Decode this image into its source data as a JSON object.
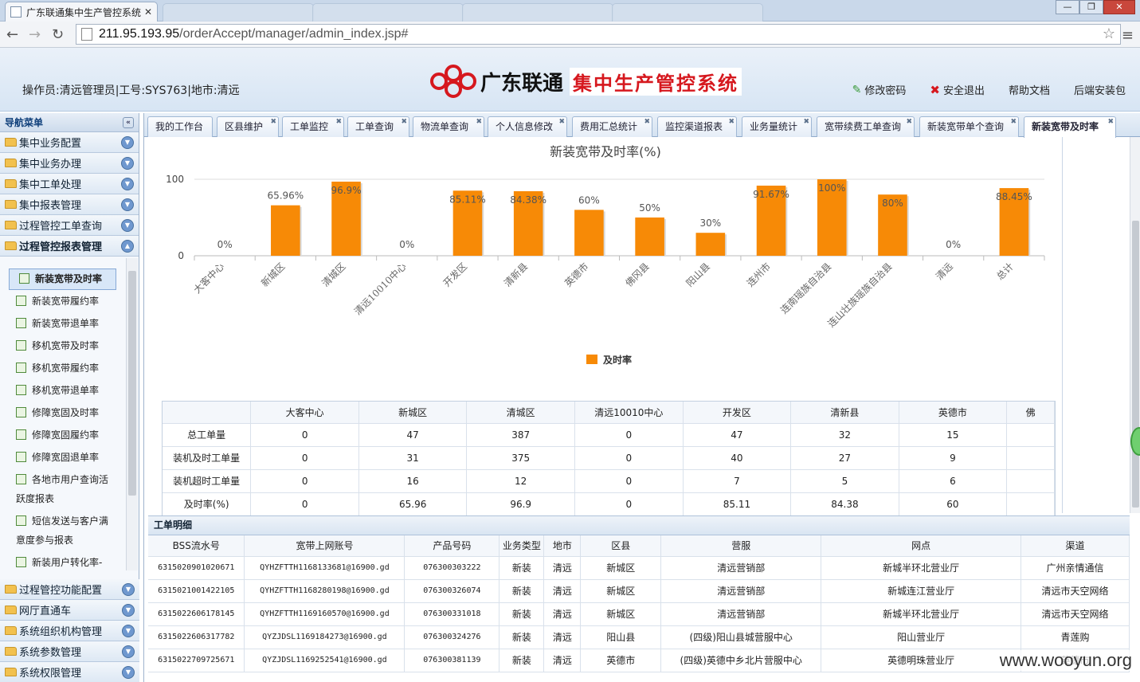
{
  "browser": {
    "tab_title": "广东联通集中生产管控系统",
    "url_host": "211.95.193.95",
    "url_path": "/orderAccept/manager/admin_index.jsp#"
  },
  "header": {
    "operator": "操作员:清远管理员|工号:SYS763|地市:清远",
    "brand": "广东联通",
    "system_name": "集中生产管控系统",
    "links": [
      "修改密码",
      "安全退出",
      "帮助文档",
      "后端安装包"
    ]
  },
  "sidebar": {
    "title": "导航菜单",
    "groups": [
      "集中业务配置",
      "集中业务办理",
      "集中工单处理",
      "集中报表管理",
      "过程管控工单查询",
      "过程管控报表管理"
    ],
    "sub_items": [
      "新装宽带及时率",
      "新装宽带履约率",
      "新装宽带退单率",
      "移机宽带及时率",
      "移机宽带履约率",
      "移机宽带退单率",
      "修障宽固及时率",
      "修障宽固履约率",
      "修障宽固退单率",
      "各地市用户查询活",
      "跃度报表",
      "短信发送与客户满",
      "意度参与报表",
      "新装用户转化率-"
    ],
    "bottom_groups": [
      "过程管控功能配置",
      "网厅直通车",
      "系统组织机构管理",
      "系统参数管理",
      "系统权限管理"
    ]
  },
  "tabs": [
    "我的工作台",
    "区县维护",
    "工单监控",
    "工单查询",
    "物流单查询",
    "个人信息修改",
    "费用汇总统计",
    "监控渠道报表",
    "业务量统计",
    "宽带续费工单查询",
    "新装宽带单个查询",
    "新装宽带及时率"
  ],
  "chart_data": {
    "type": "bar",
    "title": "新装宽带及时率(%)",
    "categories": [
      "大客中心",
      "新城区",
      "清城区",
      "清远10010中心",
      "开发区",
      "清新县",
      "英德市",
      "佛冈县",
      "阳山县",
      "连州市",
      "连南瑶族自治县",
      "连山壮族瑶族自治县",
      "清远",
      "总计"
    ],
    "series": [
      {
        "name": "及时率",
        "values": [
          0,
          65.96,
          96.9,
          0,
          85.11,
          84.38,
          60,
          50,
          30,
          91.67,
          100,
          80,
          0,
          88.45
        ]
      }
    ],
    "value_labels": [
      "0%",
      "65.96%",
      "96.9%",
      "0%",
      "85.11%",
      "84.38%",
      "60%",
      "50%",
      "30%",
      "91.67%",
      "100%",
      "80%",
      "0%",
      "88.45%"
    ],
    "y_ticks": [
      "0",
      "100"
    ],
    "ylim": [
      0,
      100
    ],
    "legend": "bottom",
    "color": "#f78a06"
  },
  "data_table": {
    "headers": [
      "",
      "大客中心",
      "新城区",
      "清城区",
      "清远10010中心",
      "开发区",
      "清新县",
      "英德市",
      "佛"
    ],
    "rows": [
      [
        "总工单量",
        "0",
        "47",
        "387",
        "0",
        "47",
        "32",
        "15",
        ""
      ],
      [
        "装机及时工单量",
        "0",
        "31",
        "375",
        "0",
        "40",
        "27",
        "9",
        ""
      ],
      [
        "装机超时工单量",
        "0",
        "16",
        "12",
        "0",
        "7",
        "5",
        "6",
        ""
      ],
      [
        "及时率(%)",
        "0",
        "65.96",
        "96.9",
        "0",
        "85.11",
        "84.38",
        "60",
        ""
      ]
    ]
  },
  "detail": {
    "title": "工单明细",
    "headers": [
      "BSS流水号",
      "宽带上网账号",
      "产品号码",
      "业务类型",
      "地市",
      "区县",
      "营服",
      "网点",
      "渠道"
    ],
    "rows": [
      [
        "6315020901020671",
        "QYHZFTTH1168133681@16900.gd",
        "076300303222",
        "新装",
        "清远",
        "新城区",
        "清远营销部",
        "新城半环北营业厅",
        "广州亲情通信"
      ],
      [
        "6315021001422105",
        "QYHZFTTH1168280198@16900.gd",
        "076300326074",
        "新装",
        "清远",
        "新城区",
        "清远营销部",
        "新城连江营业厅",
        "清远市天空网络"
      ],
      [
        "6315022606178145",
        "QYHZFTTH1169160570@16900.gd",
        "076300331018",
        "新装",
        "清远",
        "新城区",
        "清远营销部",
        "新城半环北营业厅",
        "清远市天空网络"
      ],
      [
        "6315022606317782",
        "QYZJDSL1169184273@16900.gd",
        "076300324276",
        "新装",
        "清远",
        "阳山县",
        "(四级)阳山县城营服中心",
        "阳山营业厅",
        "青莲购"
      ],
      [
        "6315022709725671",
        "QYZJDSL1169252541@16900.gd",
        "076300381139",
        "新装",
        "清远",
        "英德市",
        "(四级)英德中乡北片营服中心",
        "英德明珠营业厅",
        "英德市"
      ]
    ]
  },
  "watermark": "www.wooyun.org"
}
